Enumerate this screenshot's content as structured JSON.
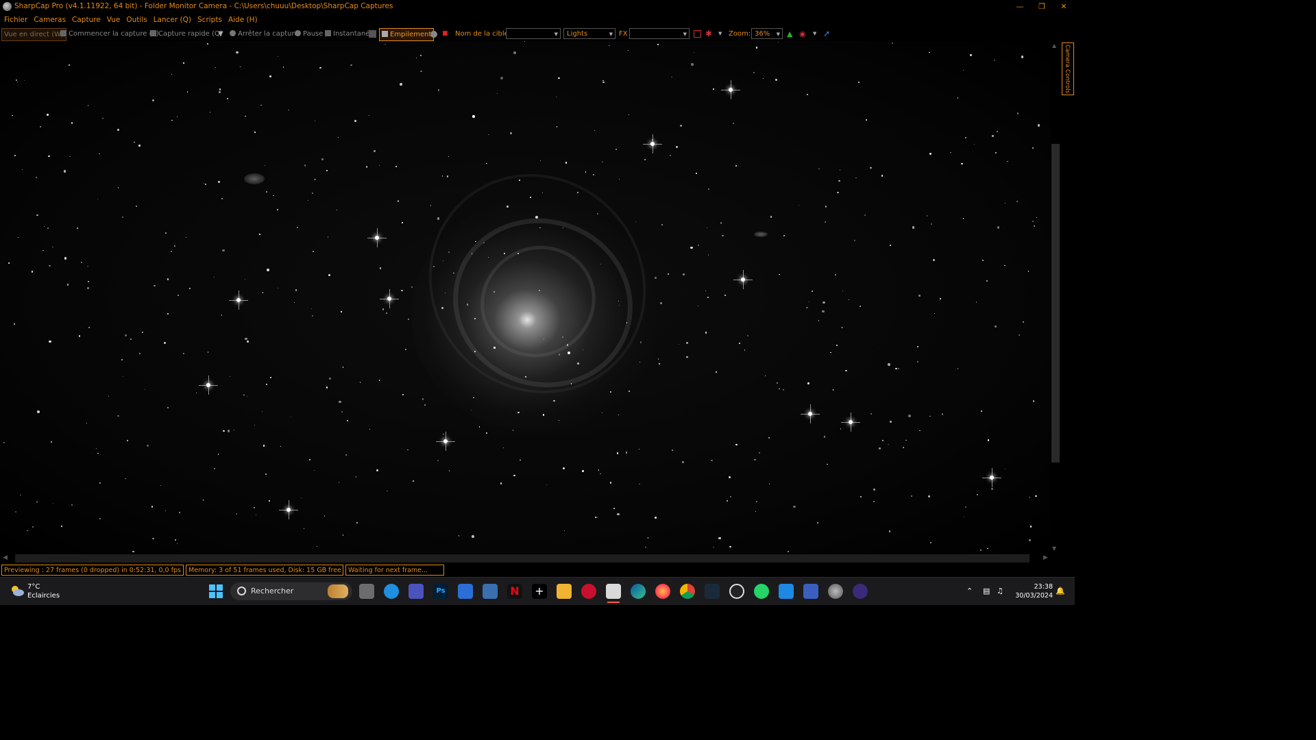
{
  "window": {
    "title": "SharpCap Pro (v4.1.11922, 64 bit) - Folder Monitor Camera - C:\\Users\\chuuu\\Desktop\\SharpCap Captures",
    "buttons": [
      "minimize-icon",
      "restore-icon",
      "close-icon"
    ]
  },
  "menu": [
    "Fichier",
    "Cameras",
    "Capture",
    "Vue",
    "Outils",
    "Lancer (Q)",
    "Scripts",
    "Aide (H)"
  ],
  "toolbar": {
    "live_view": "Vue en direct (W)",
    "start_capture": "Commencer la capture (S)",
    "quick_capture": "Capture rapide (Q)",
    "stop_capture": "Arrêter la capture",
    "pause": "Pause",
    "snapshot": "Instantané",
    "stacking": "Empilement",
    "target_label": "Nom de la cible:",
    "target_value": "",
    "frame_type": "Lights",
    "fx_label": "FX",
    "fx_value": "",
    "zoom_label": "Zoom:",
    "zoom_value": "36%"
  },
  "side_panel": {
    "tab_label": "Camera Controls"
  },
  "status": {
    "preview": "Previewing : 27 frames (0 dropped) in 0:52:31, 0,0 fps",
    "memory": "Memory: 3 of 51 frames used, Disk: 15 GB free",
    "message": "Waiting for next frame..."
  },
  "taskbar": {
    "weather_temp": "7°C",
    "weather_desc": "Eclaircies",
    "search_placeholder": "Rechercher",
    "ps_label": "Ps",
    "time": "23:38",
    "date": "30/03/2024"
  },
  "colors": {
    "accent": "#e58b1a",
    "background": "#000000",
    "taskbar": "#1b1b1d"
  }
}
